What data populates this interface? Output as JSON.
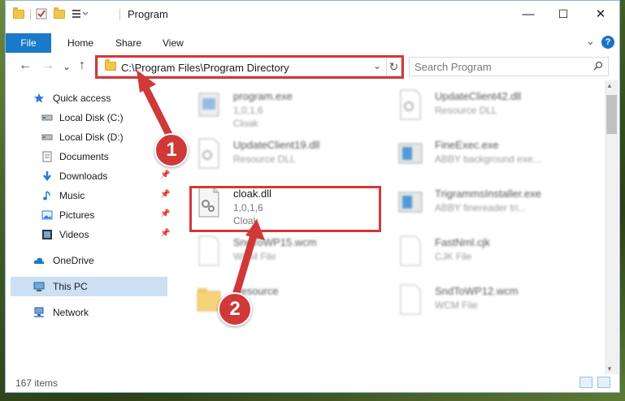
{
  "window": {
    "title": "Program",
    "minimize_symbol": "—",
    "maximize_symbol": "☐",
    "close_symbol": "✕"
  },
  "ribbon": {
    "tabs": [
      "File",
      "Home",
      "Share",
      "View"
    ],
    "help_label": "?",
    "expand_symbol": "⌄"
  },
  "nav": {
    "back_symbol": "←",
    "forward_symbol": "→",
    "recent_symbol": "⌄",
    "up_symbol": "↑",
    "address": "C:\\Program Files\\Program Directory",
    "address_dropdown_symbol": "⌄",
    "refresh_symbol": "↻",
    "search_placeholder": "Search Program"
  },
  "sidebar": {
    "items": [
      {
        "label": "Quick access",
        "icon": "star-icon",
        "pinned": false
      },
      {
        "label": "Local Disk (C:)",
        "icon": "drive-icon",
        "pinned": false
      },
      {
        "label": "Local Disk (D:)",
        "icon": "drive-icon",
        "pinned": false
      },
      {
        "label": "Documents",
        "icon": "documents-icon",
        "pinned": true
      },
      {
        "label": "Downloads",
        "icon": "download-icon",
        "pinned": true
      },
      {
        "label": "Music",
        "icon": "music-icon",
        "pinned": true
      },
      {
        "label": "Pictures",
        "icon": "pictures-icon",
        "pinned": true
      },
      {
        "label": "Videos",
        "icon": "videos-icon",
        "pinned": true
      },
      {
        "label": "OneDrive",
        "icon": "cloud-icon",
        "pinned": false
      },
      {
        "label": "This PC",
        "icon": "computer-icon",
        "pinned": false,
        "selected": true
      },
      {
        "label": "Network",
        "icon": "network-icon",
        "pinned": false
      }
    ],
    "pin_symbol": "📌"
  },
  "files": [
    {
      "name": "program.exe",
      "line1": "1,0,1,6",
      "line2": "Cloak",
      "icon": "exe-icon",
      "blurred": true
    },
    {
      "name": "UpdateClient42.dll",
      "line1": "Resource DLL",
      "line2": "",
      "icon": "dll-icon",
      "blurred": true
    },
    {
      "name": "UpdateClient19.dll",
      "line1": "Resource DLL",
      "line2": "",
      "icon": "dll-icon",
      "blurred": true
    },
    {
      "name": "FineExec.exe",
      "line1": "ABBY background exe...",
      "line2": "",
      "icon": "app-icon",
      "blurred": true
    },
    {
      "name": "cloak.dll",
      "line1": "1,0,1,6",
      "line2": "Cloak",
      "icon": "dll-gear-icon",
      "blurred": false
    },
    {
      "name": "TrigrammsInstaller.exe",
      "line1": "ABBY finereader tri...",
      "line2": "",
      "icon": "app-icon",
      "blurred": true
    },
    {
      "name": "SndToWP15.wcm",
      "line1": "WCM File",
      "line2": "",
      "icon": "blank-file-icon",
      "blurred": true
    },
    {
      "name": "FastNml.cjk",
      "line1": "CJK File",
      "line2": "",
      "icon": "blank-file-icon",
      "blurred": true
    },
    {
      "name": "Resource",
      "line1": "",
      "line2": "",
      "icon": "folder-icon",
      "blurred": true
    },
    {
      "name": "SndToWP12.wcm",
      "line1": "WCM File",
      "line2": "",
      "icon": "blank-file-icon",
      "blurred": true
    }
  ],
  "status": {
    "item_count": "167 items"
  },
  "callouts": [
    "1",
    "2"
  ],
  "colors": {
    "accent": "#1979ca",
    "highlight_red": "#d03a3a",
    "callout_red": "#d13838",
    "selected_bg": "#cce0f4"
  }
}
